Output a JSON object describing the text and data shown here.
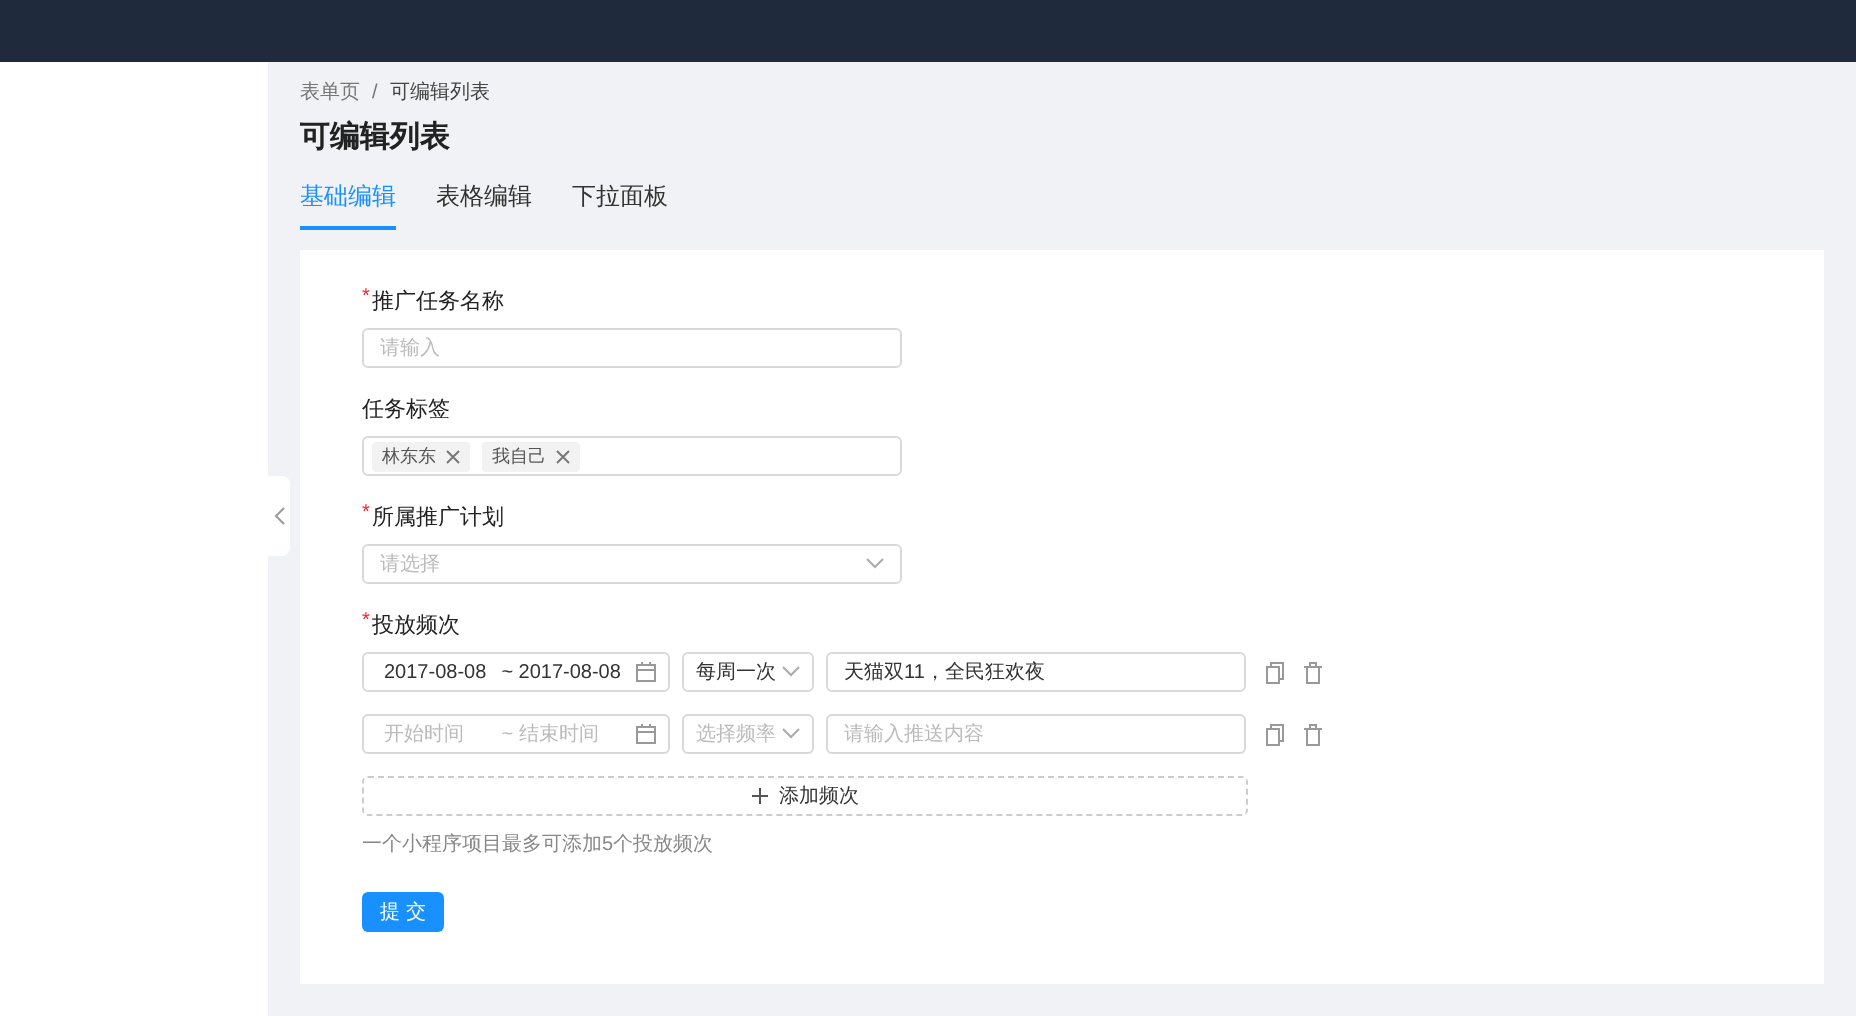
{
  "breadcrumb": [
    "表单页",
    "可编辑列表"
  ],
  "breadcrumb_separator": "/",
  "title": "可编辑列表",
  "tabs": [
    {
      "label": "基础编辑",
      "selected": true
    },
    {
      "label": "表格编辑",
      "selected": false
    },
    {
      "label": "下拉面板",
      "selected": false
    }
  ],
  "form": {
    "fields": [
      {
        "kind": "input",
        "label": "推广任务名称",
        "required_mark": "*",
        "placeholder": "请输入"
      },
      {
        "kind": "tags",
        "label": "任务标签",
        "tags": [
          "林东东",
          "我自己"
        ]
      },
      {
        "kind": "select",
        "label": "所属推广计划",
        "required_mark": "*",
        "placeholder": "请选择"
      },
      {
        "kind": "frequency",
        "label": "投放频次",
        "required_mark": "*",
        "rows": [
          {
            "start": "2017-08-08",
            "end": "2017-08-08",
            "separator": "~",
            "frequency": "每周一次",
            "content": "天猫双11，全民狂欢夜"
          },
          {
            "start_placeholder": "开始时间",
            "end_placeholder": "结束时间",
            "separator": "~",
            "frequency_placeholder": "选择频率",
            "content_placeholder": "请输入推送内容"
          }
        ],
        "add_label": "添加频次",
        "hint": "一个小程序项目最多可添加5个投放频次"
      }
    ],
    "submit": "提 交"
  }
}
